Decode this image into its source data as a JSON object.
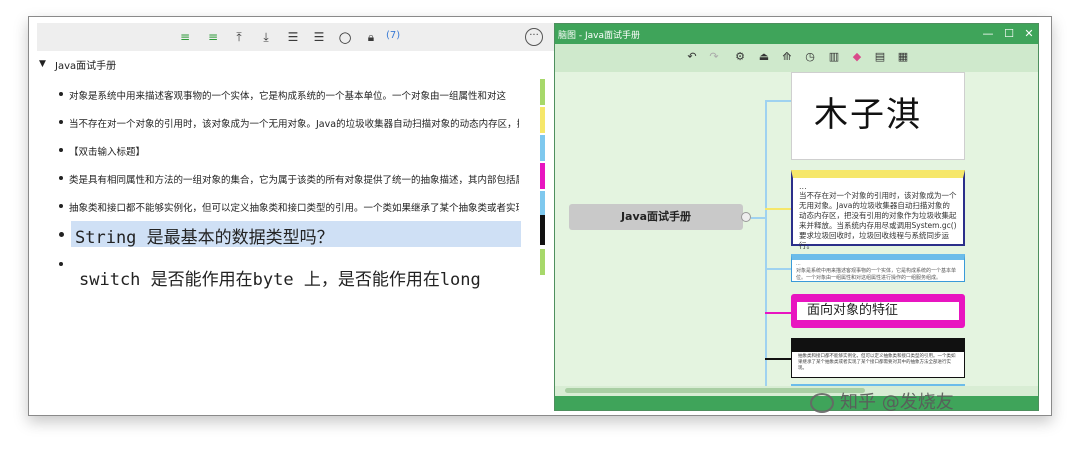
{
  "left_toolbar": {
    "icons": [
      "indent-icon",
      "outdent-icon",
      "move-up-icon",
      "move-down-icon",
      "expand-icon",
      "collapse-icon",
      "search-icon",
      "lock-icon"
    ],
    "count": "(7)",
    "more_icon": "more-icon"
  },
  "outline": {
    "title": "Java面试手册",
    "items": [
      {
        "text": "对象是系统中用来描述客观事物的一个实体，它是构成系统的一个基本单位。一个对象由一组属性和对这",
        "tag_color": "#a7d86a"
      },
      {
        "text": "当不存在对一个对象的引用时，该对象成为一个无用对象。Java的垃圾收集器自动扫描对象的动态内存区，把没有...",
        "tag_color": "#f6e76a"
      },
      {
        "text": "【双击输入标题】",
        "tag_color": "#7ec8ee"
      },
      {
        "text": "类是具有相同属性和方法的一组对象的集合，它为属于该类的所有对象提供了统一的抽象描述，其内部包括属性和...",
        "tag_color": "#e815c0"
      },
      {
        "text": "抽象类和接口都不能够实例化，但可以定义抽象类和接口类型的引用。一个类如果继承了某个抽象类或者实现了某...",
        "tag_color": "#7ec8ee"
      },
      {
        "text": "String 是最基本的数据类型吗？",
        "tag_color": "#111111"
      },
      {
        "text": "switch 是否能作用在byte 上，是否能作用在long",
        "tag_color": "#a7d86a"
      }
    ]
  },
  "mindmap": {
    "window_title": "脑图 - Java面试手册",
    "toolbar_icons": [
      "undo-icon",
      "redo-icon",
      "settings-icon",
      "export-icon",
      "share-icon",
      "timer-icon",
      "layout-icon",
      "theme-icon",
      "save-icon",
      "image-icon"
    ],
    "central": "Java面试手册",
    "signature_text": "木子淇",
    "text_node_ellipsis": "...",
    "text_node_body": "当不存在对一个对象的引用时，该对象成为一个无用对象。Java的垃圾收集器自动扫描对象的动态内存区，把没有引用的对象作为垃圾收集起来并释放。当系统内存用尽或调用System.gc()要求垃圾回收时，垃圾回收线程与系统同步运行。",
    "blue_node_ellipsis": "...",
    "blue_node_body": "对象是系统中用来描述客观事物的一个实体，它是构成系统的一个基本单位。一个对象由一组属性和对这组属性进行操作的一组服务组成。",
    "pink_node": "面向对象的特征",
    "dark_node_body": "抽象类和接口都不能够实例化，但可以定义抽象类和接口类型的引用。一个类如果继承了某个抽象类或者实现了某个接口都需要对其中的抽象方法全部进行实现。"
  },
  "watermark": "知乎 @发烧友"
}
